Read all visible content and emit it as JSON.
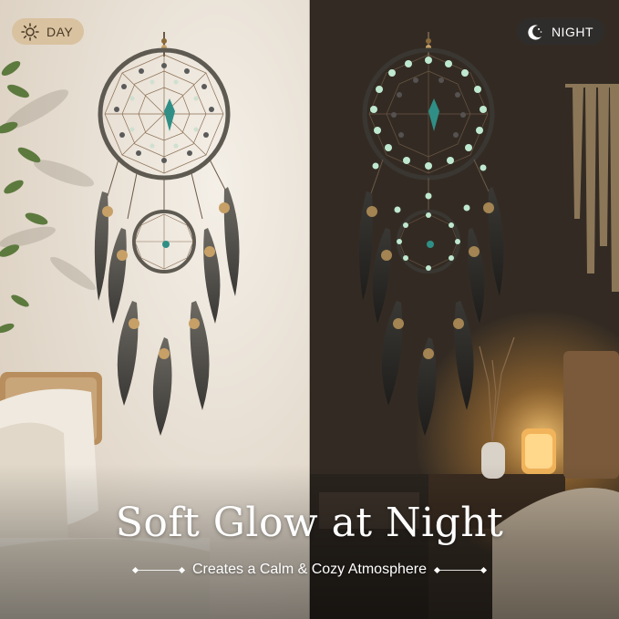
{
  "badges": {
    "day": {
      "label": "DAY",
      "icon": "sun-icon"
    },
    "night": {
      "label": "NIGHT",
      "icon": "moon-stars-icon"
    }
  },
  "headline": "Soft Glow at Night",
  "subline": "Creates a Calm & Cozy Atmosphere",
  "colors": {
    "day_badge_bg": "#d9c2a0",
    "night_badge_bg": "#2f2d2c",
    "glow_bead": "#bfe8d0",
    "turquoise": "#2f8f86"
  }
}
